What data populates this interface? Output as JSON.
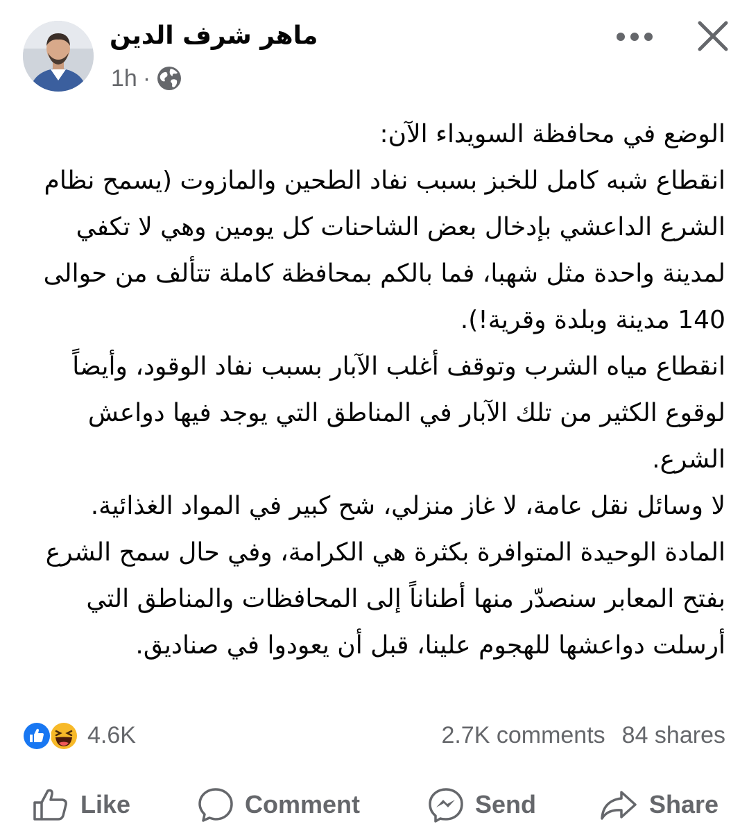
{
  "post": {
    "author_name": "ماهر شرف الدين",
    "timestamp": "1h",
    "separator": "·",
    "privacy_icon": "globe-icon",
    "paragraphs": [
      "الوضع في محافظة السويداء الآن:",
      "انقطاع شبه كامل للخبز بسبب نفاد الطحين والمازوت (يسمح نظام الشرع الداعشي بإدخال بعض الشاحنات كل يومين وهي لا تكفي لمدينة واحدة مثل شهبا، فما بالكم بمحافظة كاملة تتألف من حوالى 140 مدينة وبلدة وقرية!).",
      "انقطاع مياه الشرب وتوقف أغلب الآبار بسبب نفاد الوقود، وأيضاً لوقوع الكثير من تلك الآبار في المناطق التي يوجد فيها دواعش الشرع.",
      "لا وسائل نقل عامة، لا غاز منزلي، شح كبير في المواد الغذائية.",
      "المادة الوحيدة المتوافرة بكثرة هي الكرامة، وفي حال سمح الشرع بفتح المعابر سنصدّر منها أطناناً إلى المحافظات والمناطق التي أرسلت دواعشها للهجوم علينا، قبل أن يعودوا في صناديق."
    ]
  },
  "stats": {
    "reactions_count": "4.6K",
    "reaction_icons": [
      "like-icon",
      "haha-icon"
    ],
    "comments": "2.7K comments",
    "shares": "84 shares"
  },
  "actions": {
    "like": "Like",
    "comment": "Comment",
    "send": "Send",
    "share": "Share"
  },
  "colors": {
    "secondary_text": "#65676b",
    "like_blue": "#1877f2",
    "haha_yellow": "#f7b928"
  }
}
